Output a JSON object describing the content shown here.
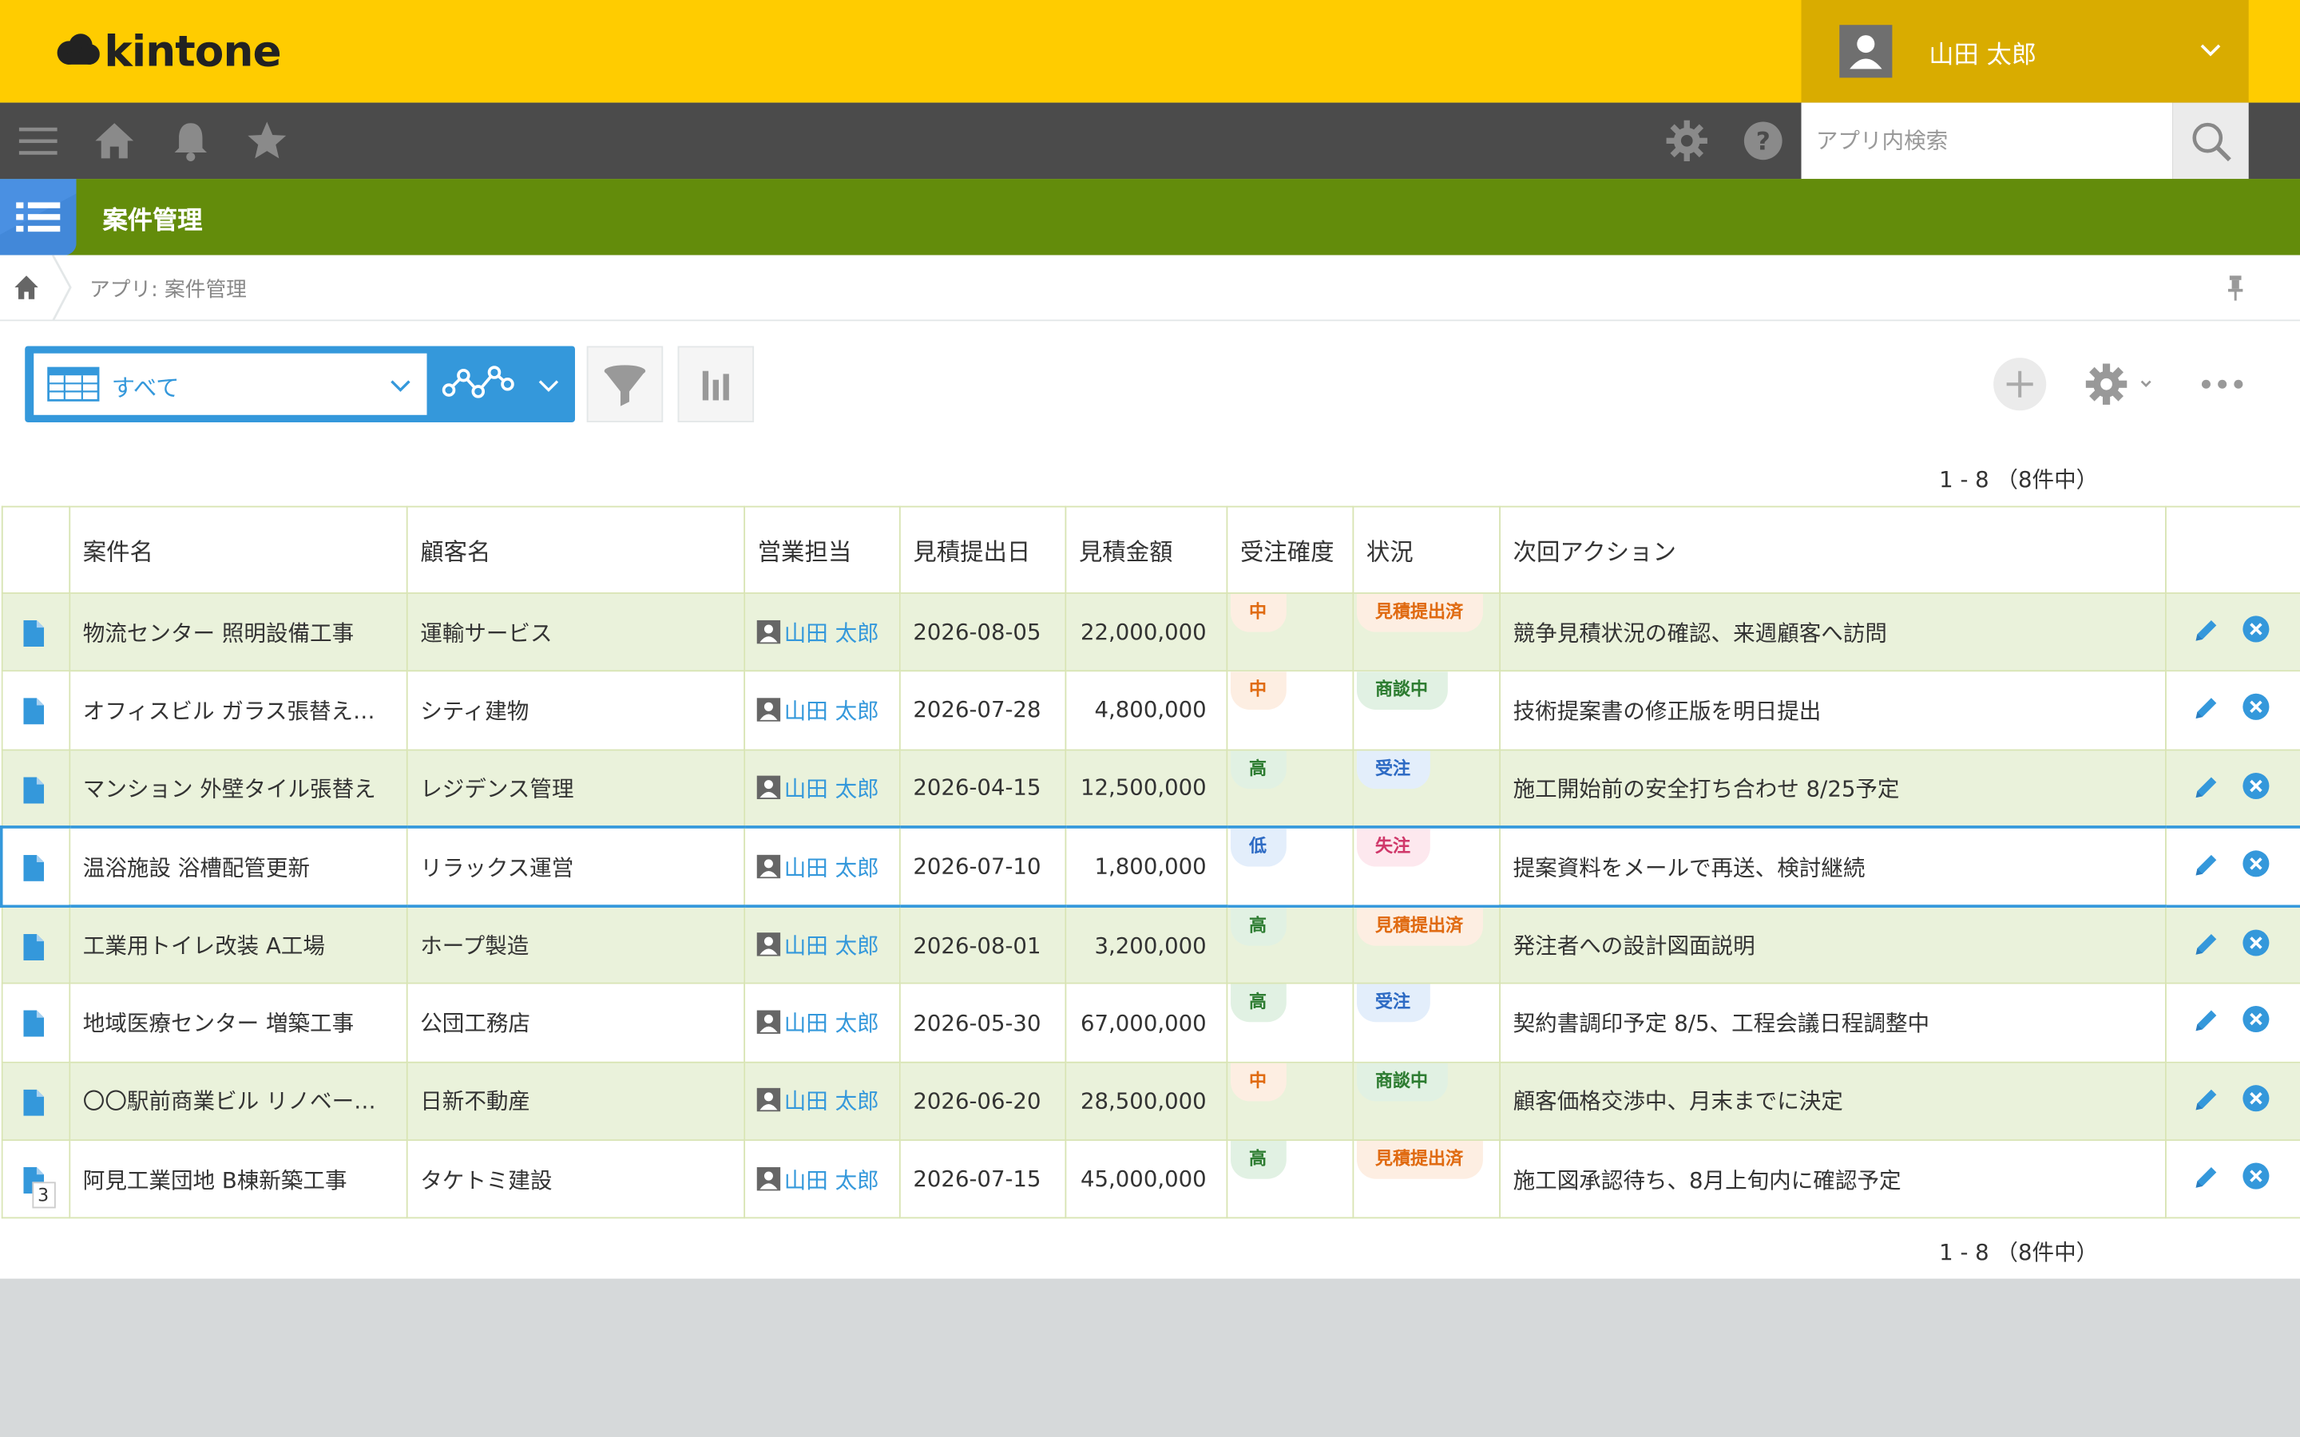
{
  "header": {
    "logo_text": "kintone",
    "user_name": "山田 太郎"
  },
  "nav": {
    "search_placeholder": "アプリ内検索"
  },
  "app": {
    "title": "案件管理"
  },
  "breadcrumb": {
    "text": "アプリ: 案件管理"
  },
  "toolbar": {
    "view_label": "すべて"
  },
  "pager": {
    "text": "1 - 8 （8件中）"
  },
  "table": {
    "columns": [
      "案件名",
      "顧客名",
      "営業担当",
      "見積提出日",
      "見積金額",
      "受注確度",
      "状況",
      "次回アクション"
    ],
    "rows": [
      {
        "name": "物流センター 照明設備工事",
        "customer": "運輸サービス",
        "rep": "山田 太郎",
        "date": "2026-08-05",
        "amount": "22,000,000",
        "certainty": "中",
        "status": "見積提出済",
        "next_action": "競争見積状況の確認、来週顧客へ訪問"
      },
      {
        "name": "オフィスビル ガラス張替え…",
        "customer": "シティ建物",
        "rep": "山田 太郎",
        "date": "2026-07-28",
        "amount": "4,800,000",
        "certainty": "中",
        "status": "商談中",
        "next_action": "技術提案書の修正版を明日提出"
      },
      {
        "name": "マンション 外壁タイル張替え",
        "customer": "レジデンス管理",
        "rep": "山田 太郎",
        "date": "2026-04-15",
        "amount": "12,500,000",
        "certainty": "高",
        "status": "受注",
        "next_action": "施工開始前の安全打ち合わせ 8/25予定"
      },
      {
        "name": "温浴施設 浴槽配管更新",
        "customer": "リラックス運営",
        "rep": "山田 太郎",
        "date": "2026-07-10",
        "amount": "1,800,000",
        "certainty": "低",
        "status": "失注",
        "next_action": "提案資料をメールで再送、検討継続"
      },
      {
        "name": "工業用トイレ改装 A工場",
        "customer": "ホープ製造",
        "rep": "山田 太郎",
        "date": "2026-08-01",
        "amount": "3,200,000",
        "certainty": "高",
        "status": "見積提出済",
        "next_action": "発注者への設計図面説明"
      },
      {
        "name": "地域医療センター 増築工事",
        "customer": "公団工務店",
        "rep": "山田 太郎",
        "date": "2026-05-30",
        "amount": "67,000,000",
        "certainty": "高",
        "status": "受注",
        "next_action": "契約書調印予定 8/5、工程会議日程調整中"
      },
      {
        "name": "〇〇駅前商業ビル リノベー…",
        "customer": "日新不動産",
        "rep": "山田 太郎",
        "date": "2026-06-20",
        "amount": "28,500,000",
        "certainty": "中",
        "status": "商談中",
        "next_action": "顧客価格交渉中、月末までに決定"
      },
      {
        "name": "阿見工業団地 B棟新築工事",
        "customer": "タケトミ建設",
        "rep": "山田 太郎",
        "date": "2026-07-15",
        "amount": "45,000,000",
        "certainty": "高",
        "status": "見積提出済",
        "next_action": "施工図承認待ち、8月上旬内に確認予定",
        "doc_badge": "3"
      }
    ]
  },
  "colors": {
    "header_yellow": "#ffcc00",
    "nav_dark": "#4b4b4b",
    "app_green": "#638c0b",
    "accent_blue": "#3498db"
  }
}
